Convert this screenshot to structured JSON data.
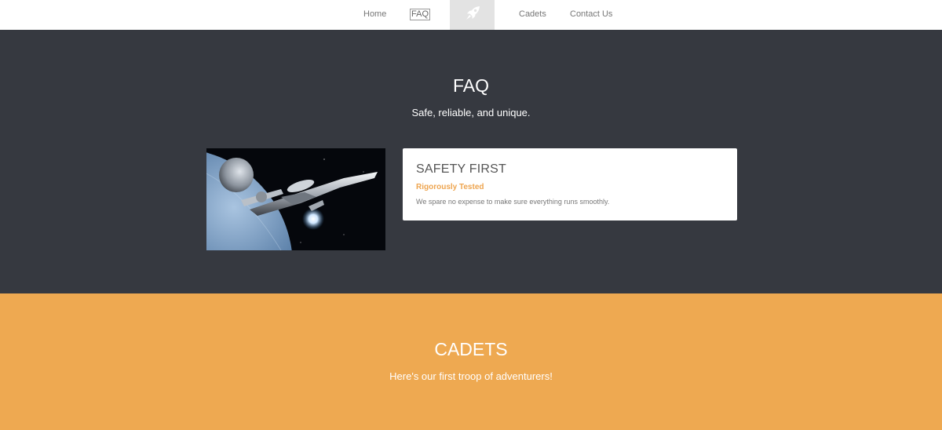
{
  "nav": {
    "items": [
      {
        "label": "Home",
        "active": false
      },
      {
        "label": "FAQ",
        "active": true
      },
      {
        "label": "Cadets",
        "active": false
      },
      {
        "label": "Contact Us",
        "active": false
      }
    ],
    "logo_icon": "rocket-icon"
  },
  "faq": {
    "title": "FAQ",
    "subtitle": "Safe, reliable, and unique.",
    "image_subject": "starship orbiting planet",
    "card": {
      "title": "SAFETY FIRST",
      "subtitle": "Rigorously Tested",
      "text": "We spare no expense to make sure everything runs smoothly."
    }
  },
  "cadets": {
    "title": "CADETS",
    "subtitle": "Here's our first troop of adventurers!"
  },
  "colors": {
    "nav_bg": "#ffffff",
    "logo_bg": "#e3e3e3",
    "faq_bg": "#363940",
    "card_bg": "#ffffff",
    "accent_orange": "#eea550",
    "cadets_bg": "#eea951",
    "heading_text": "#ffffff"
  }
}
